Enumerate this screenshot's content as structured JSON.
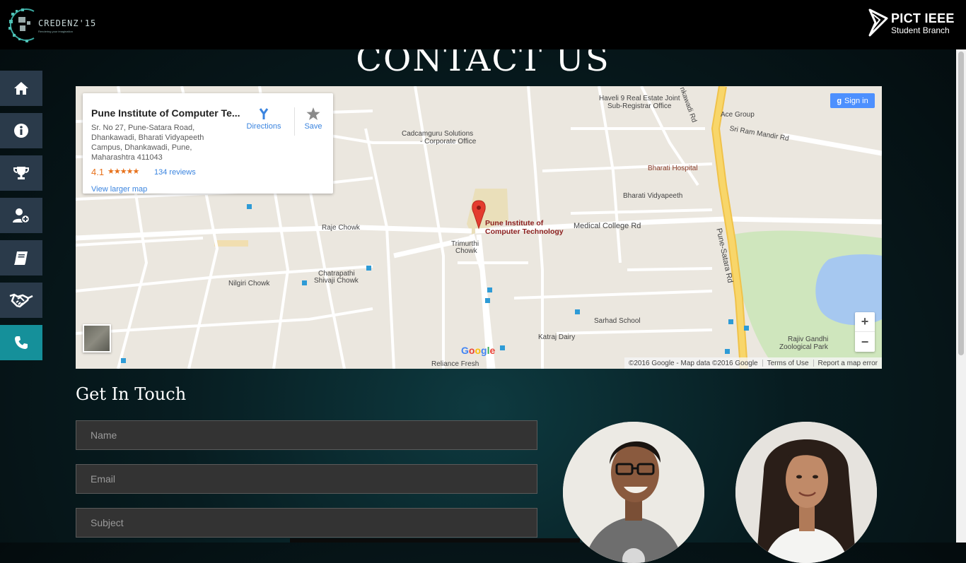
{
  "header": {
    "left_logo_text": "CREDENZ'15",
    "left_logo_tagline": "Rendering your imagination",
    "right_logo_title": "PICT IEEE",
    "right_logo_subtitle": "Student Branch"
  },
  "sidebar": {
    "items": [
      {
        "icon": "home-icon",
        "active": false
      },
      {
        "icon": "info-icon",
        "active": false
      },
      {
        "icon": "trophy-icon",
        "active": false
      },
      {
        "icon": "user-add-icon",
        "active": false
      },
      {
        "icon": "book-icon",
        "active": false
      },
      {
        "icon": "handshake-icon",
        "active": false
      },
      {
        "icon": "phone-icon",
        "active": true
      }
    ],
    "colors": {
      "default": "#2a3a4a",
      "active": "#15909a"
    }
  },
  "page": {
    "title": "CONTACT US"
  },
  "map": {
    "place_name": "Pune Institute of Computer Te...",
    "address": "Sr. No 27, Pune-Satara Road, Dhankawadi, Bharati Vidyapeeth Campus, Dhankawadi, Pune, Maharashtra 411043",
    "rating": "4.1",
    "stars": "★★★★★",
    "reviews": "134 reviews",
    "larger_map": "View larger map",
    "directions": "Directions",
    "save": "Save",
    "sign_in": "Sign in",
    "zoom_in": "+",
    "zoom_out": "−",
    "google": "Google",
    "copyright": "©2016 Google - Map data ©2016 Google",
    "terms": "Terms of Use",
    "report": "Report a map error",
    "labels": {
      "haveli": "Haveli 9 Real Estate Joint",
      "haveli2": "Sub-Registrar Office",
      "ace": "Ace Group",
      "sriram": "Sri Ram Mandir Rd",
      "cadcam": "Cadcamguru Solutions",
      "cadcam2": "- Corporate Office",
      "bharati_hospital": "Bharati Hospital",
      "bharati_vid": "Bharati Vidyapeeth",
      "pict1": "Pune Institute of",
      "pict2": "Computer Technology",
      "medical": "Medical College Rd",
      "raje": "Raje Chowk",
      "trimurthi1": "Trimurthi",
      "trimurthi2": "Chowk",
      "chatrapathi1": "Chatrapathi",
      "chatrapathi2": "Shivaji Chowk",
      "nilgiri": "Nilgiri Chowk",
      "sarhad": "Sarhad School",
      "katraj": "Katraj Dairy",
      "reliance": "Reliance Fresh",
      "rajiv1": "Rajiv Gandhi",
      "rajiv2": "Zoological Park",
      "punesatara": "Pune-Satara Rd",
      "ankawadi": "nkawadi Rd"
    }
  },
  "contact": {
    "heading": "Get In Touch",
    "name_placeholder": "Name",
    "email_placeholder": "Email",
    "subject_placeholder": "Subject"
  }
}
